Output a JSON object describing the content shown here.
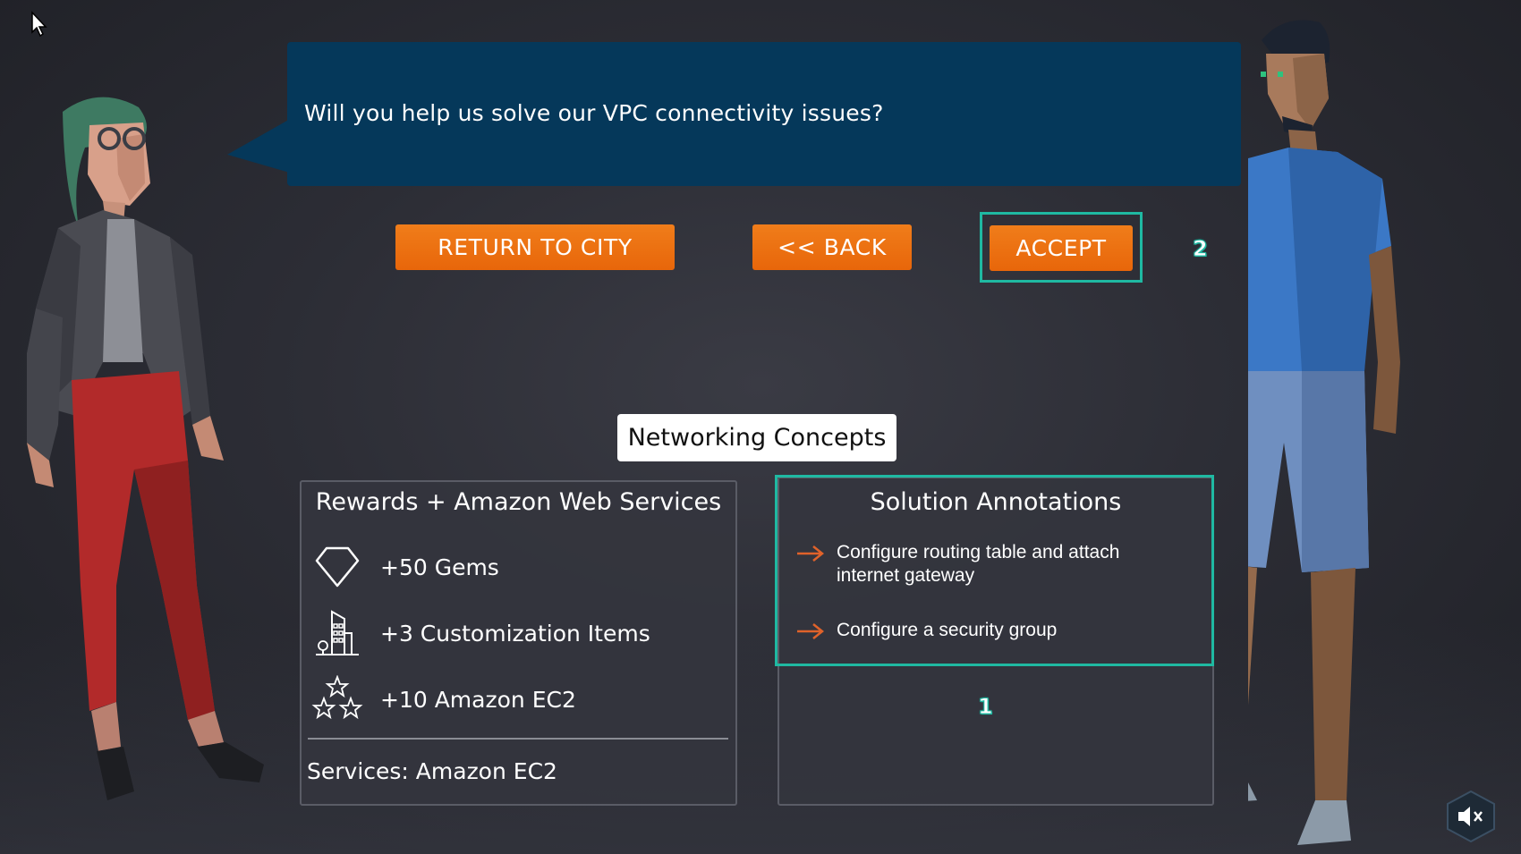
{
  "dialog": {
    "speech": "Will you help us solve our VPC connectivity issues?"
  },
  "buttons": {
    "return_label": "RETURN TO CITY",
    "back_label": "<< BACK",
    "accept_label": "ACCEPT"
  },
  "steps": {
    "badge_1": "1",
    "badge_2": "2"
  },
  "topic": {
    "label": "Networking Concepts"
  },
  "rewards": {
    "title": "Rewards + Amazon Web Services",
    "items": [
      {
        "icon": "gem-icon",
        "label": "+50 Gems"
      },
      {
        "icon": "building-icon",
        "label": "+3 Customization Items"
      },
      {
        "icon": "stars-icon",
        "label": "+10 Amazon EC2"
      }
    ],
    "services": "Services: Amazon EC2"
  },
  "solution": {
    "title": "Solution Annotations",
    "items": [
      {
        "icon": "arrow-right-icon",
        "label": "Configure routing table and attach internet gateway"
      },
      {
        "icon": "arrow-right-icon",
        "label": "Configure a security group"
      }
    ]
  },
  "controls": {
    "mute_icon": "speaker-muted-icon"
  },
  "colors": {
    "accent_orange": "#ea6c0c",
    "highlight_teal": "#1fb9a2",
    "speech_bg": "#05385a",
    "background": "#2c2d35"
  }
}
